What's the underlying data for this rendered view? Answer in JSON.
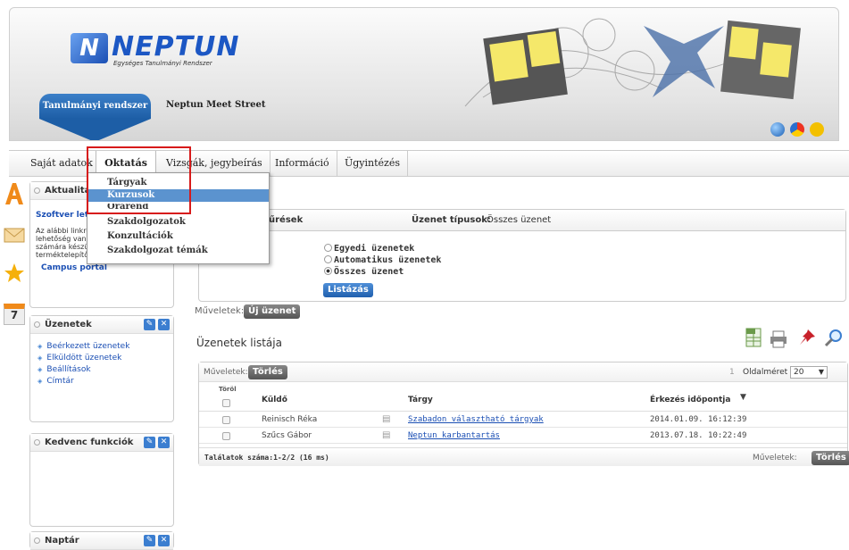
{
  "header": {
    "logo_title": "NEPTUN",
    "logo_subtitle": "Egységes Tanulmányi Rendszer",
    "logo_icon": "N",
    "tabs": [
      {
        "label": "Tanulmányi rendszer"
      },
      {
        "label": "Neptun Meet Street"
      }
    ]
  },
  "menu": {
    "items": [
      {
        "label": "Saját adatok"
      },
      {
        "label": "Oktatás"
      },
      {
        "label": "Vizsgák, jegybeírás"
      },
      {
        "label": "Információ"
      },
      {
        "label": "Ügyintézés"
      }
    ],
    "dropdown": [
      {
        "label": "Tárgyak"
      },
      {
        "label": "Kurzusok"
      },
      {
        "label": "Órarend"
      },
      {
        "label": "Szakdolgozatok"
      },
      {
        "label": "Konzultációk"
      },
      {
        "label": "Szakdolgozat témák"
      }
    ]
  },
  "left": {
    "news": {
      "title": "Aktualitások",
      "headline": "Szoftver letöl",
      "text_lines": [
        "Az alábbi linkre",
        "lehetőség van a",
        "számára készü",
        "terméktelepítő"
      ],
      "link": "Campus portál"
    },
    "messages": {
      "title": "Üzenetek",
      "links": [
        "Beérkezett üzenetek",
        "Elküldött üzenetek",
        "Beállítások",
        "Címtár"
      ]
    },
    "favorites": {
      "title": "Kedvenc funkciók"
    },
    "calendar": {
      "title": "Naptár"
    },
    "calendar_icon_day": "7"
  },
  "filter": {
    "section_title": "űrések",
    "type_label": "Üzenet típusok:",
    "type_value": "Összes üzenet",
    "options": [
      "Egyedi üzenetek",
      "Automatikus üzenetek",
      "Összes üzenet"
    ],
    "list_button": "Listázás"
  },
  "actions": {
    "label": "Műveletek:",
    "new_message": "Új üzenet",
    "delete": "Törlés"
  },
  "list": {
    "title": "Üzenetek listája",
    "page_size_label": "Oldalméret",
    "page_size": "20",
    "page_number": "1",
    "columns": {
      "delete": "Töröl",
      "sender": "Küldő",
      "subject": "Tárgy",
      "arrival": "Érkezés időpontja"
    },
    "rows": [
      {
        "sender": "Reinisch Réka",
        "subject": "Szabadon választható tárgyak",
        "date": "2014.01.09. 16:12:39"
      },
      {
        "sender": "Szűcs Gábor",
        "subject": "Neptun karbantartás",
        "date": "2013.07.18. 10:22:49"
      }
    ],
    "footer": "Találatok száma:1-2/2 (16 ms)"
  },
  "colors": {
    "accent": "#1c57c4",
    "highlight": "#d71a1a"
  }
}
